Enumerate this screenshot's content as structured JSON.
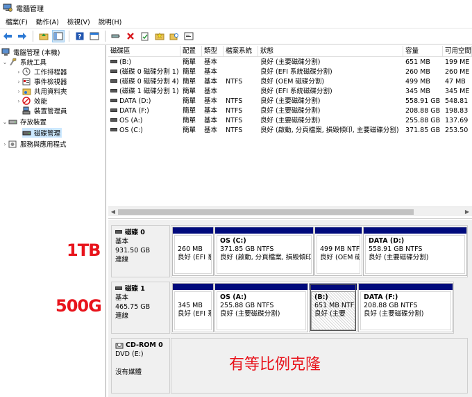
{
  "window": {
    "title": "電腦管理"
  },
  "menu": [
    "檔案(F)",
    "動作(A)",
    "檢視(V)",
    "說明(H)"
  ],
  "toolbar": {
    "icons": [
      "back-arrow-icon",
      "forward-arrow-icon",
      "folder-up-icon",
      "properties-panel-icon",
      "help-icon",
      "panel-icon",
      "connect-icon",
      "delete-x-icon",
      "check-document-icon",
      "folder-star-icon",
      "search-folder-icon",
      "console-icon"
    ]
  },
  "tree": [
    {
      "label": "電腦管理 (本機)",
      "indent": 0,
      "expander": "",
      "icon": "computer-manage-icon"
    },
    {
      "label": "系統工具",
      "indent": 1,
      "expander": "⌄",
      "icon": "tools-icon"
    },
    {
      "label": "工作排程器",
      "indent": 2,
      "expander": "›",
      "icon": "clock-icon"
    },
    {
      "label": "事件檢視器",
      "indent": 2,
      "expander": "›",
      "icon": "event-viewer-icon"
    },
    {
      "label": "共用資料夾",
      "indent": 2,
      "expander": "›",
      "icon": "shared-folder-icon"
    },
    {
      "label": "效能",
      "indent": 2,
      "expander": "›",
      "icon": "performance-icon"
    },
    {
      "label": "裝置管理員",
      "indent": 2,
      "expander": "",
      "icon": "device-manager-icon"
    },
    {
      "label": "存放裝置",
      "indent": 1,
      "expander": "⌄",
      "icon": "storage-icon"
    },
    {
      "label": "磁碟管理",
      "indent": 2,
      "expander": "",
      "icon": "disk-management-icon",
      "selected": true
    },
    {
      "label": "服務與應用程式",
      "indent": 1,
      "expander": "›",
      "icon": "services-icon"
    }
  ],
  "volumes": {
    "columns": [
      "磁碟區",
      "配置",
      "類型",
      "檔案系統",
      "狀態",
      "容量",
      "可用空間"
    ],
    "rows": [
      [
        "(B:)",
        "簡單",
        "基本",
        "",
        "良好 (主要磁碟分割)",
        "651 MB",
        "199 ME"
      ],
      [
        "(磁碟 0 磁碟分割 1)",
        "簡單",
        "基本",
        "",
        "良好 (EFI 系統磁碟分割)",
        "260 MB",
        "260 ME"
      ],
      [
        "(磁碟 0 磁碟分割 4)",
        "簡單",
        "基本",
        "NTFS",
        "良好 (OEM 磁碟分割)",
        "499 MB",
        "47 MB"
      ],
      [
        "(磁碟 1 磁碟分割 1)",
        "簡單",
        "基本",
        "",
        "良好 (EFI 系統磁碟分割)",
        "345 MB",
        "345 ME"
      ],
      [
        "DATA (D:)",
        "簡單",
        "基本",
        "NTFS",
        "良好 (主要磁碟分割)",
        "558.91 GB",
        "548.81"
      ],
      [
        "DATA (F:)",
        "簡單",
        "基本",
        "NTFS",
        "良好 (主要磁碟分割)",
        "208.88 GB",
        "198.83"
      ],
      [
        "OS (A:)",
        "簡單",
        "基本",
        "NTFS",
        "良好 (主要磁碟分割)",
        "255.88 GB",
        "137.69"
      ],
      [
        "OS (C:)",
        "簡單",
        "基本",
        "NTFS",
        "良好 (啟動, 分頁檔案, 損毀傾印, 主要磁碟分割)",
        "371.85 GB",
        "253.50"
      ]
    ]
  },
  "disks": [
    {
      "name": "磁碟 0",
      "type": "基本",
      "size": "931.50 GB",
      "status": "連線",
      "partitions": [
        {
          "name": "",
          "size": "260 MB",
          "status": "良好 (EFI 系"
        },
        {
          "name": "OS  (C:)",
          "size": "371.85 GB NTFS",
          "status": "良好 (啟動, 分頁檔案, 損毀傾印"
        },
        {
          "name": "",
          "size": "499 MB NTF",
          "status": "良好 (OEM 磁"
        },
        {
          "name": "DATA  (D:)",
          "size": "558.91 GB NTFS",
          "status": "良好 (主要磁碟分割)"
        }
      ]
    },
    {
      "name": "磁碟 1",
      "type": "基本",
      "size": "465.75 GB",
      "status": "連線",
      "partitions": [
        {
          "name": "",
          "size": "345 MB",
          "status": "良好 (EFI 系"
        },
        {
          "name": "OS  (A:)",
          "size": "255.88 GB NTFS",
          "status": "良好 (主要磁碟分割)"
        },
        {
          "name": "(B:)",
          "size": "651 MB NTF",
          "status": "良好 (主要"
        },
        {
          "name": "DATA  (F:)",
          "size": "208.88 GB NTFS",
          "status": "良好 (主要磁碟分割)"
        }
      ]
    },
    {
      "name": "CD-ROM 0",
      "type": "DVD (E:)",
      "size": "",
      "status": "沒有媒體"
    }
  ],
  "annotations": {
    "disk0": "1TB",
    "disk1": "500G",
    "note": "有等比例克隆"
  },
  "colors": {
    "partition_bar": "#000a7c",
    "annotation": "#e8131b",
    "selection": "#cce8ff"
  }
}
